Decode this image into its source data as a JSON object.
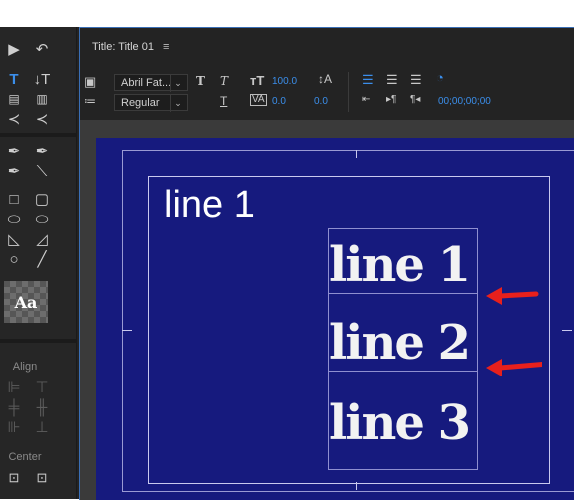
{
  "panel": {
    "title": "Title: Title 01",
    "menu_icon": "hamburger-menu-icon"
  },
  "toolbar": {
    "font_family": "Abril Fat...",
    "font_style": "Regular",
    "font_size": "100.0",
    "kerning": "0.0",
    "tracking": "0.0",
    "timecode": "00;00;00;00"
  },
  "tools": {
    "align_label": "Align",
    "center_label": "Center",
    "style_swatch": "Aa"
  },
  "canvas": {
    "small_text": "line 1",
    "lines": [
      "line 1",
      "line 2",
      "line 3"
    ]
  },
  "colors": {
    "accent": "#3b8eea",
    "canvas_bg": "#161a7e",
    "arrow": "#e8201c"
  }
}
